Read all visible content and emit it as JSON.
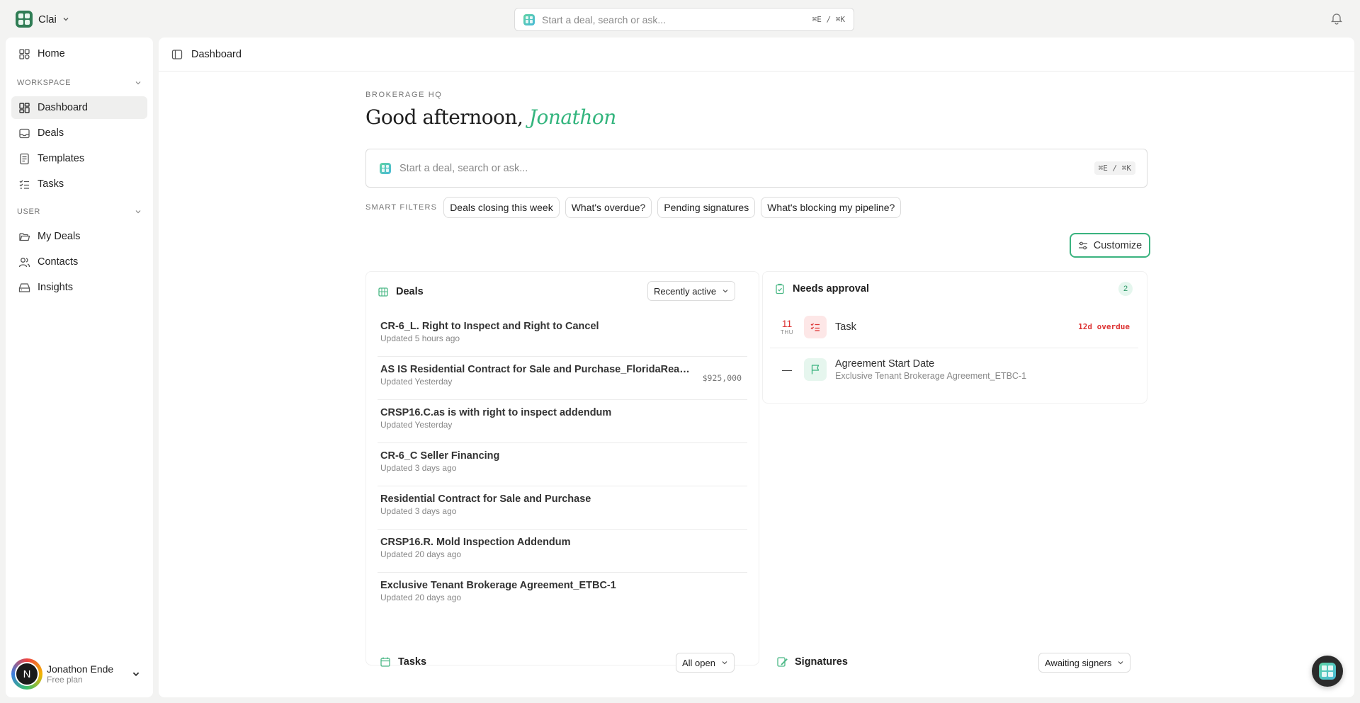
{
  "app": {
    "name": "Clai"
  },
  "topbar": {
    "search_placeholder": "Start a deal, search or ask...",
    "search_shortcut": "⌘E / ⌘K"
  },
  "sidebar": {
    "home": "Home",
    "workspace_label": "WORKSPACE",
    "workspace_items": [
      {
        "label": "Dashboard",
        "icon": "dashboard-icon",
        "active": true
      },
      {
        "label": "Deals",
        "icon": "inbox-icon"
      },
      {
        "label": "Templates",
        "icon": "document-icon"
      },
      {
        "label": "Tasks",
        "icon": "checklist-icon"
      }
    ],
    "user_label": "USER",
    "user_items": [
      {
        "label": "My Deals",
        "icon": "folder-icon"
      },
      {
        "label": "Contacts",
        "icon": "users-icon"
      },
      {
        "label": "Insights",
        "icon": "drive-icon"
      }
    ],
    "user": {
      "name": "Jonathon Ende",
      "plan": "Free plan",
      "initial": "N"
    }
  },
  "main": {
    "breadcrumb": "Dashboard",
    "eyebrow": "BROKERAGE HQ",
    "greeting_prefix": "Good afternoon,",
    "greeting_name": "Jonathon",
    "search_placeholder": "Start a deal, search or ask...",
    "search_shortcut": "⌘E / ⌘K",
    "smart_filters_label": "SMART FILTERS",
    "smart_filters": [
      "Deals closing this week",
      "What's overdue?",
      "Pending signatures",
      "What's blocking my pipeline?"
    ],
    "customize_label": "Customize"
  },
  "deals_card": {
    "title": "Deals",
    "filter": "Recently active",
    "rows": [
      {
        "title": "CR-6_L. Right to Inspect and Right to Cancel",
        "sub": "Updated 5 hours ago",
        "price": ""
      },
      {
        "title": "AS IS Residential Contract for Sale and Purchase_FloridaRealtors",
        "sub": "Updated Yesterday",
        "price": "$925,000"
      },
      {
        "title": "CRSP16.C.as is with right to inspect addendum",
        "sub": "Updated Yesterday",
        "price": ""
      },
      {
        "title": "CR-6_C Seller Financing",
        "sub": "Updated 3 days ago",
        "price": ""
      },
      {
        "title": "Residential Contract for Sale and Purchase",
        "sub": "Updated 3 days ago",
        "price": ""
      },
      {
        "title": "CRSP16.R. Mold Inspection Addendum",
        "sub": "Updated 20 days ago",
        "price": ""
      },
      {
        "title": "Exclusive Tenant Brokerage Agreement_ETBC-1",
        "sub": "Updated 20 days ago",
        "price": ""
      }
    ]
  },
  "approval_card": {
    "title": "Needs approval",
    "count": "2",
    "rows": [
      {
        "date_num": "11",
        "date_dow": "THU",
        "title": "Task",
        "sub": "",
        "status": "12d overdue"
      },
      {
        "date_num": "—",
        "date_dow": "",
        "title": "Agreement Start Date",
        "sub": "Exclusive Tenant Brokerage Agreement_ETBC-1",
        "status": ""
      }
    ]
  },
  "tasks_card": {
    "title": "Tasks",
    "filter": "All open"
  },
  "signatures_card": {
    "title": "Signatures",
    "filter": "Awaiting signers"
  },
  "colors": {
    "accent": "#34b57e",
    "overdue": "#d33333"
  }
}
